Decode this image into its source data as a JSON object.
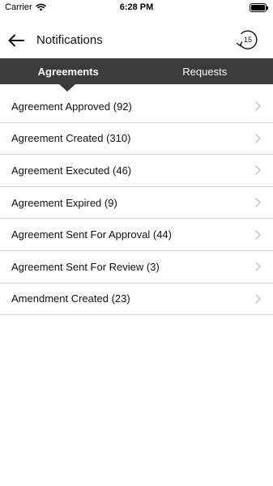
{
  "status_bar": {
    "carrier": "Carrier",
    "time": "6:28 PM"
  },
  "header": {
    "title": "Notifications",
    "refresh_count": "15"
  },
  "tabs": [
    {
      "label": "Agreements",
      "active": true
    },
    {
      "label": "Requests",
      "active": false
    }
  ],
  "list": {
    "items": [
      {
        "label": "Agreement Approved (92)"
      },
      {
        "label": "Agreement Created (310)"
      },
      {
        "label": "Agreement Executed (46)"
      },
      {
        "label": "Agreement Expired (9)"
      },
      {
        "label": "Agreement Sent For Approval (44)"
      },
      {
        "label": "Agreement Sent For Review (3)"
      },
      {
        "label": "Amendment Created (23)"
      }
    ]
  },
  "colors": {
    "tab_bar": "#3b3b3b",
    "divider": "#d8d8d8",
    "chevron": "#c4c4c4"
  }
}
